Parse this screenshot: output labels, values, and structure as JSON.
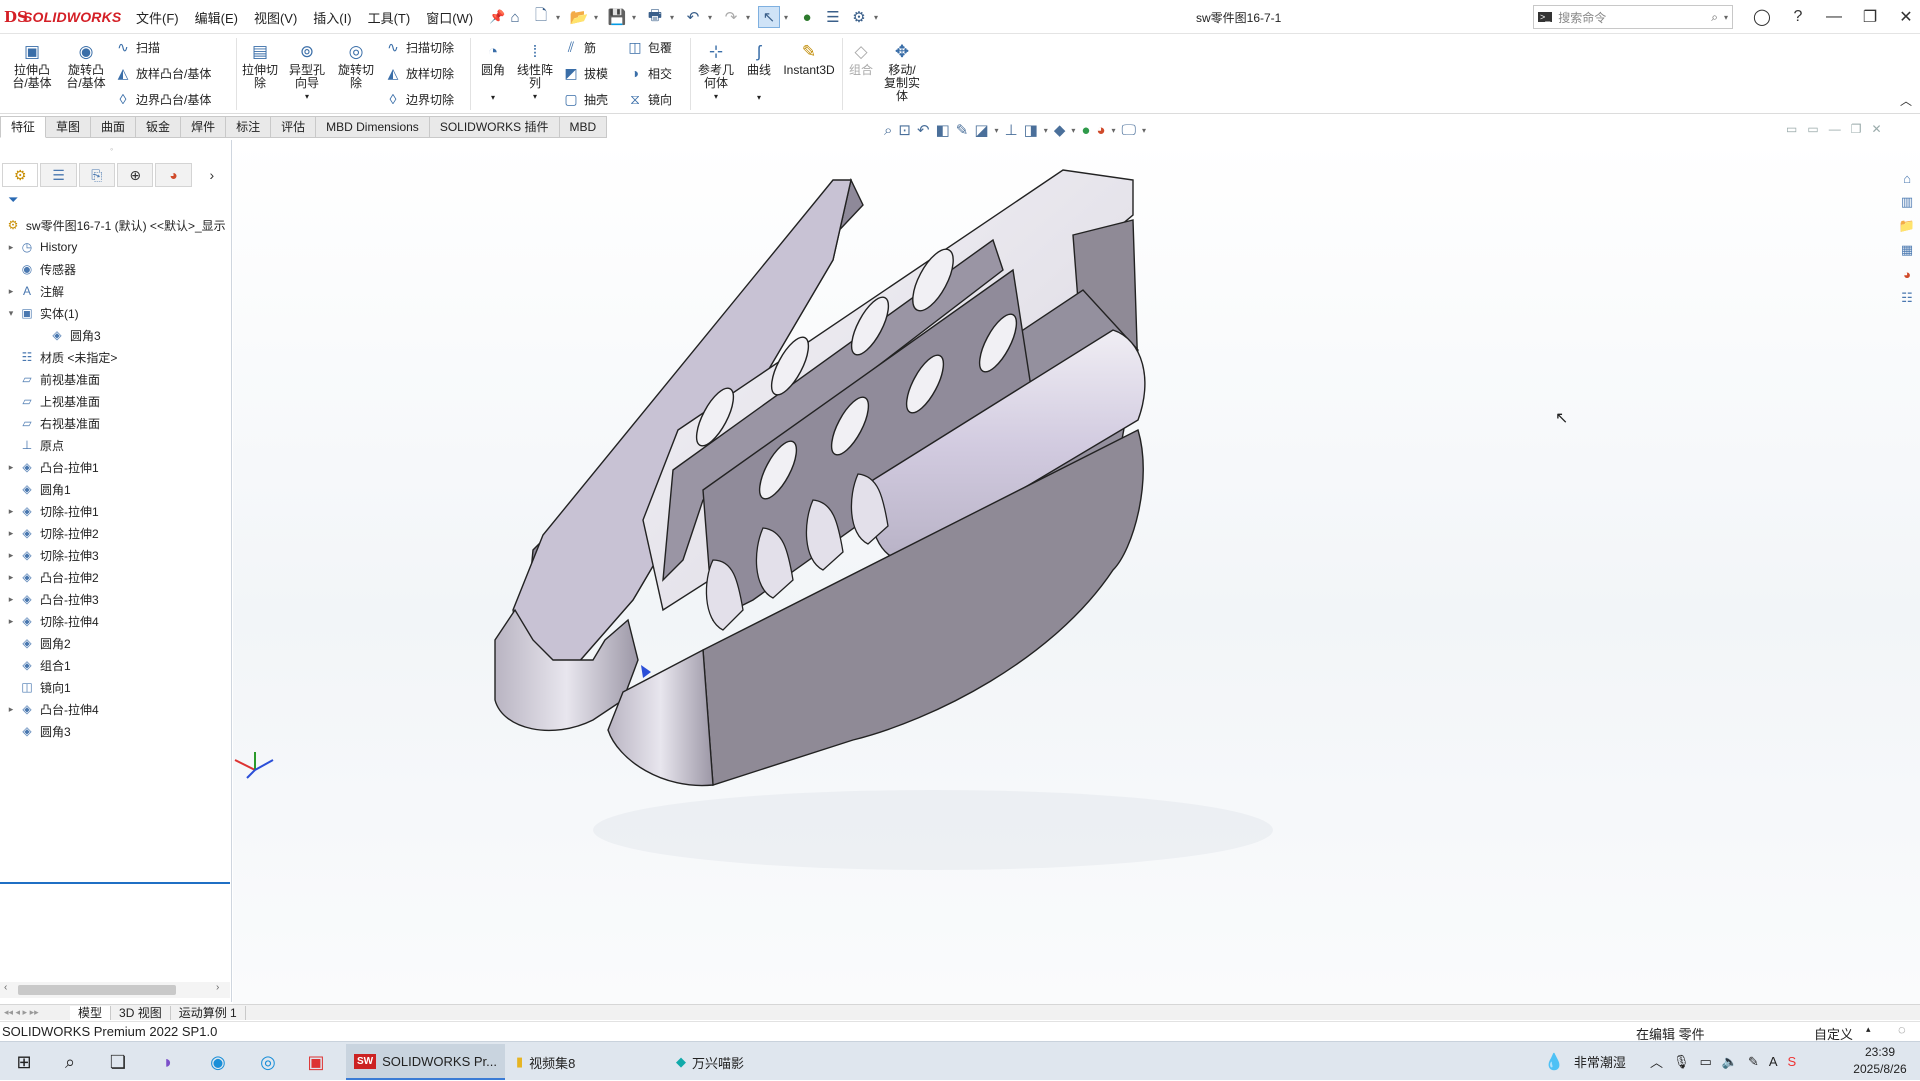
{
  "app": {
    "logo_mark": "DS",
    "logo_text": "SOLIDWORKS",
    "doc_title": "sw零件图16-7-1"
  },
  "menu": [
    "文件(F)",
    "编辑(E)",
    "视图(V)",
    "插入(I)",
    "工具(T)",
    "窗口(W)"
  ],
  "search": {
    "placeholder": "搜索命令"
  },
  "commands": {
    "extrude_boss": "拉伸凸\n台/基体",
    "revolve_boss": "旋转凸\n台/基体",
    "sweep": "扫描",
    "loft_boss": "放样凸台/基体",
    "boundary_boss": "边界凸台/基体",
    "extrude_cut": "拉伸切\n除",
    "hole_wizard": "异型孔\n向导",
    "revolve_cut": "旋转切\n除",
    "sweep_cut": "扫描切除",
    "loft_cut": "放样切除",
    "boundary_cut": "边界切除",
    "fillet": "圆角",
    "linear_pattern": "线性阵\n列",
    "rib": "筋",
    "draft": "拔模",
    "shell": "抽壳",
    "wrap": "包覆",
    "intersect": "相交",
    "mirror": "镜向",
    "ref_geometry": "参考几\n何体",
    "curves": "曲线",
    "instant3d": "Instant3D",
    "combine": "组合",
    "move_copy": "移动/\n复制实\n体"
  },
  "tabs": [
    "特征",
    "草图",
    "曲面",
    "钣金",
    "焊件",
    "标注",
    "评估",
    "MBD Dimensions",
    "SOLIDWORKS 插件",
    "MBD"
  ],
  "tree": {
    "root": "sw零件图16-7-1 (默认) <<默认>_显示",
    "items": [
      {
        "label": "History",
        "exp": "▸",
        "icon": "◷",
        "indent": 0
      },
      {
        "label": "传感器",
        "exp": "",
        "icon": "◉",
        "indent": 0
      },
      {
        "label": "注解",
        "exp": "▸",
        "icon": "A",
        "indent": 0
      },
      {
        "label": "实体(1)",
        "exp": "▾",
        "icon": "▣",
        "indent": 0
      },
      {
        "label": "圆角3",
        "exp": "",
        "icon": "◈",
        "indent": 1
      },
      {
        "label": "材质 <未指定>",
        "exp": "",
        "icon": "☷",
        "indent": 0
      },
      {
        "label": "前视基准面",
        "exp": "",
        "icon": "▱",
        "indent": 0
      },
      {
        "label": "上视基准面",
        "exp": "",
        "icon": "▱",
        "indent": 0
      },
      {
        "label": "右视基准面",
        "exp": "",
        "icon": "▱",
        "indent": 0
      },
      {
        "label": "原点",
        "exp": "",
        "icon": "⊥",
        "indent": 0
      },
      {
        "label": "凸台-拉伸1",
        "exp": "▸",
        "icon": "◈",
        "indent": 0
      },
      {
        "label": "圆角1",
        "exp": "",
        "icon": "◈",
        "indent": 0
      },
      {
        "label": "切除-拉伸1",
        "exp": "▸",
        "icon": "◈",
        "indent": 0
      },
      {
        "label": "切除-拉伸2",
        "exp": "▸",
        "icon": "◈",
        "indent": 0
      },
      {
        "label": "切除-拉伸3",
        "exp": "▸",
        "icon": "◈",
        "indent": 0
      },
      {
        "label": "凸台-拉伸2",
        "exp": "▸",
        "icon": "◈",
        "indent": 0
      },
      {
        "label": "凸台-拉伸3",
        "exp": "▸",
        "icon": "◈",
        "indent": 0
      },
      {
        "label": "切除-拉伸4",
        "exp": "▸",
        "icon": "◈",
        "indent": 0
      },
      {
        "label": "圆角2",
        "exp": "",
        "icon": "◈",
        "indent": 0
      },
      {
        "label": "组合1",
        "exp": "",
        "icon": "◈",
        "indent": 0
      },
      {
        "label": "镜向1",
        "exp": "",
        "icon": "◫",
        "indent": 0
      },
      {
        "label": "凸台-拉伸4",
        "exp": "▸",
        "icon": "◈",
        "indent": 0
      },
      {
        "label": "圆角3",
        "exp": "",
        "icon": "◈",
        "indent": 0
      }
    ]
  },
  "bottom_tabs": [
    "模型",
    "3D 视图",
    "运动算例 1"
  ],
  "status": {
    "product": "SOLIDWORKS Premium 2022 SP1.0",
    "editing": "在编辑 零件",
    "custom": "自定义"
  },
  "taskbar": {
    "apps": [
      "SOLIDWORKS Pr...",
      "视频集8",
      "万兴喵影"
    ],
    "weather": "非常潮湿",
    "time": "23:39",
    "date": "2025/8/26"
  },
  "colors": {
    "brand": "#d41f26",
    "tab_active": "#ffffff",
    "part_face": "#8f8a96",
    "part_light": "#e9e7ee",
    "selection": "#1f6fc4"
  }
}
